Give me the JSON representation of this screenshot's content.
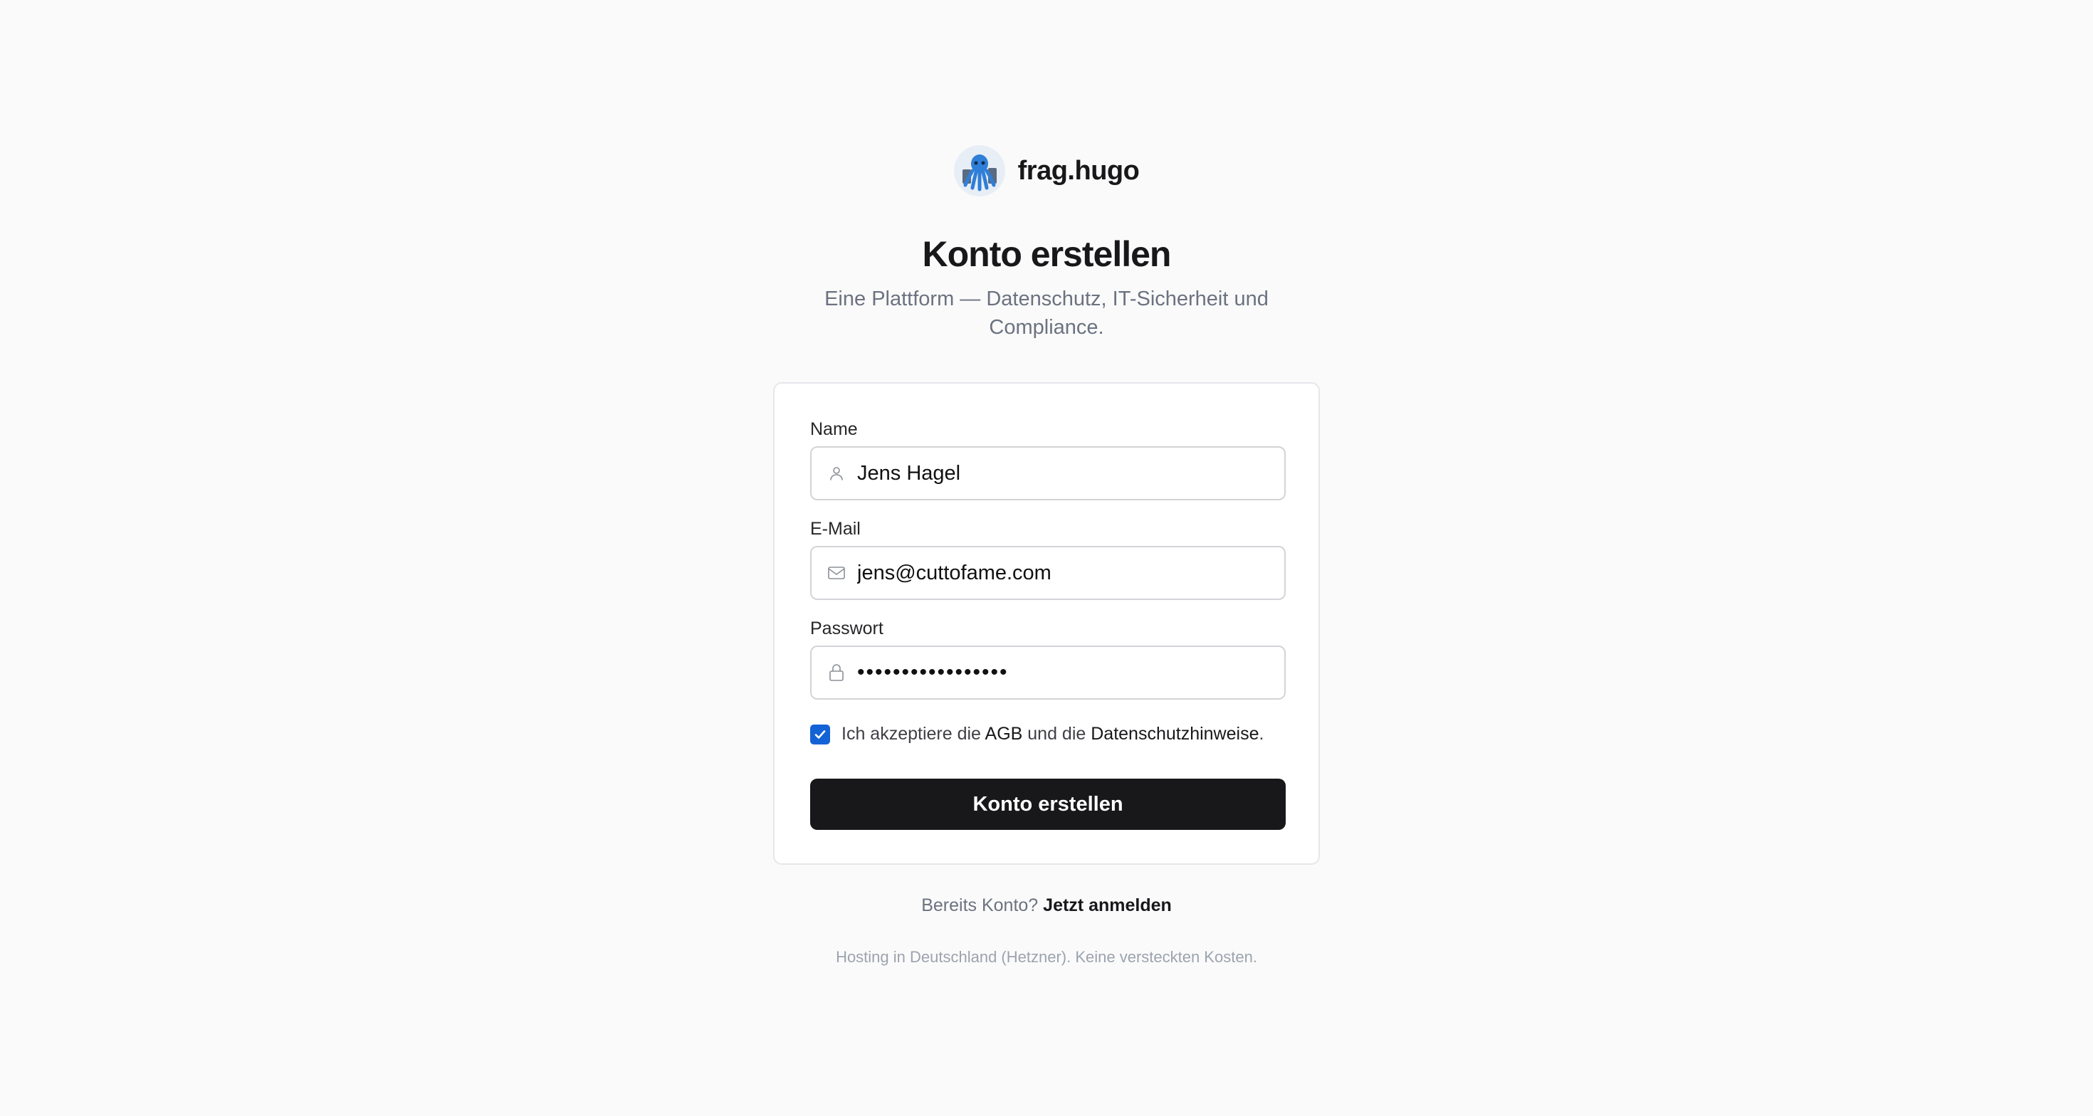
{
  "brand": {
    "name": "frag.hugo",
    "logo_icon": "octopus-mascot-icon"
  },
  "heading": {
    "title": "Konto erstellen",
    "subtitle": "Eine Plattform — Datenschutz, IT-Sicherheit und Compliance."
  },
  "form": {
    "name": {
      "label": "Name",
      "value": "Jens Hagel",
      "icon": "user-icon"
    },
    "email": {
      "label": "E-Mail",
      "value": "jens@cuttofame.com",
      "icon": "mail-icon"
    },
    "password": {
      "label": "Passwort",
      "value": "•••••••••••••••••",
      "icon": "lock-icon"
    },
    "consent": {
      "checked": true,
      "text_before": "Ich akzeptiere die ",
      "terms_link": "AGB",
      "text_middle": " und die ",
      "privacy_link": "Datenschutzhinweise",
      "text_after": "."
    },
    "submit_label": "Konto erstellen"
  },
  "login": {
    "prompt": "Bereits Konto?",
    "link": "Jetzt anmelden"
  },
  "footer": {
    "note": "Hosting in Deutschland (Hetzner). Keine versteckten Kosten."
  },
  "colors": {
    "background": "#fafafa",
    "primary": "#18181b",
    "checkbox": "#1463d6",
    "muted_text": "#6b7280"
  }
}
